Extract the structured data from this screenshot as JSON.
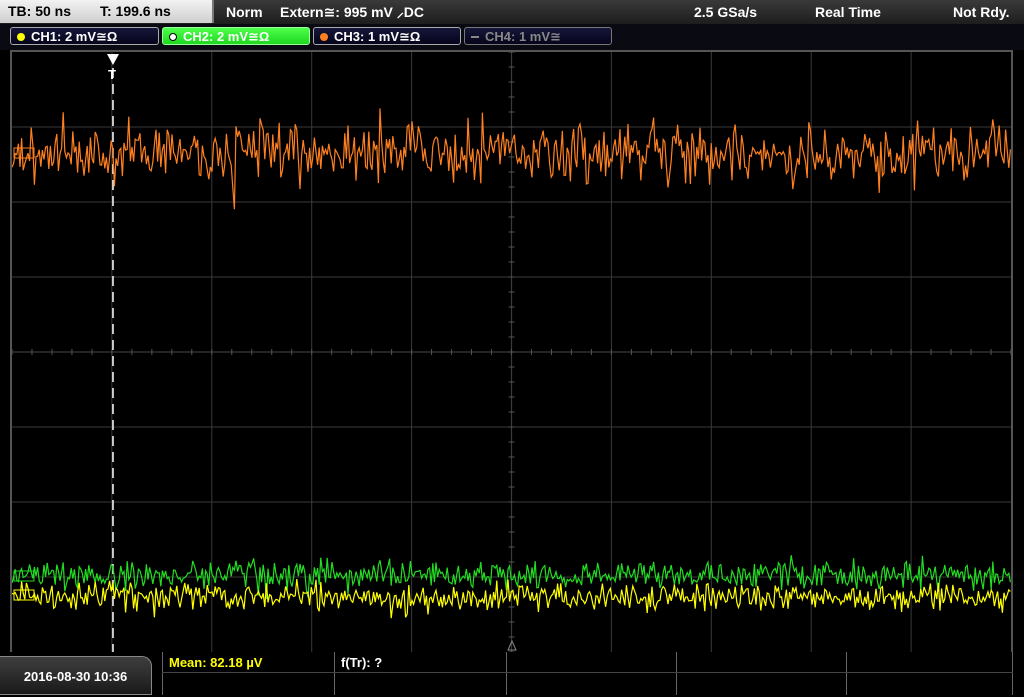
{
  "topbar": {
    "timebase": "TB: 50 ns",
    "trigger_time": "T: 199.6 ns",
    "trigger_mode": "Norm",
    "trigger_source": "Extern≅: 995 mV ⸝DC",
    "sample_rate": "2.5 GSa/s",
    "acq_mode": "Real Time",
    "status": "Not Rdy."
  },
  "channels": [
    {
      "label": "CH1: 2 mV≅Ω",
      "color": "#ffff00"
    },
    {
      "label": "CH2: 2 mV≅Ω",
      "color": "#22dd22"
    },
    {
      "label": "CH3: 1 mV≅Ω",
      "color": "#ff8020"
    },
    {
      "label": "CH4: 1 mV≅",
      "color": "#888888"
    }
  ],
  "trigger_marker": "T",
  "bottombar": {
    "datetime": "2016-08-30 10:36",
    "meas1": "Mean: 82.18 µV",
    "meas2": "f(Tr): ?"
  },
  "colors": {
    "ch1": "#ffff00",
    "ch2": "#22dd22",
    "ch3": "#ff8020",
    "grid": "#3a3a3a"
  }
}
